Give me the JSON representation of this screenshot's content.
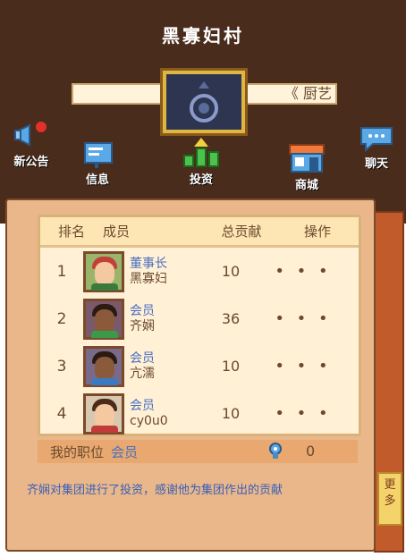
{
  "header": {
    "village_name": "黑寡妇村",
    "marquee_text": "《 厨艺",
    "emblem_icon": "shield-emblem-icon"
  },
  "hud": {
    "announcement": {
      "label": "新公告",
      "icon": "megaphone-icon",
      "badge_color": "#e2302a"
    },
    "messages": {
      "label": "信息",
      "icon": "message-board-icon"
    },
    "invest": {
      "label": "投资",
      "icon": "investment-chart-icon"
    },
    "shop": {
      "label": "商城",
      "icon": "shop-icon"
    },
    "chat": {
      "label": "聊天",
      "icon": "chat-bubble-icon"
    }
  },
  "board": {
    "headers": {
      "rank": "排名",
      "member": "成员",
      "total": "总贡献",
      "ops": "操作"
    },
    "rows": [
      {
        "rank": "1",
        "role": "董事长",
        "name": "黑寡妇",
        "contribution": "10",
        "ops": "• • •"
      },
      {
        "rank": "2",
        "role": "会员",
        "name": "齐娴",
        "contribution": "36",
        "ops": "• • •"
      },
      {
        "rank": "3",
        "role": "会员",
        "name": "亢濡",
        "contribution": "10",
        "ops": "• • •"
      },
      {
        "rank": "4",
        "role": "会员",
        "name": "cy0u0",
        "contribution": "10",
        "ops": "• • •"
      }
    ]
  },
  "my_position": {
    "label": "我的职位",
    "value": "会员",
    "count": "0"
  },
  "news": "齐娴对集团进行了投资，感谢他为集团作出的贡献",
  "more_tab": "更多",
  "colors": {
    "role_text": "#4a6fc0",
    "panel": "#e9b78a",
    "top_bg": "#4a2c1c"
  }
}
